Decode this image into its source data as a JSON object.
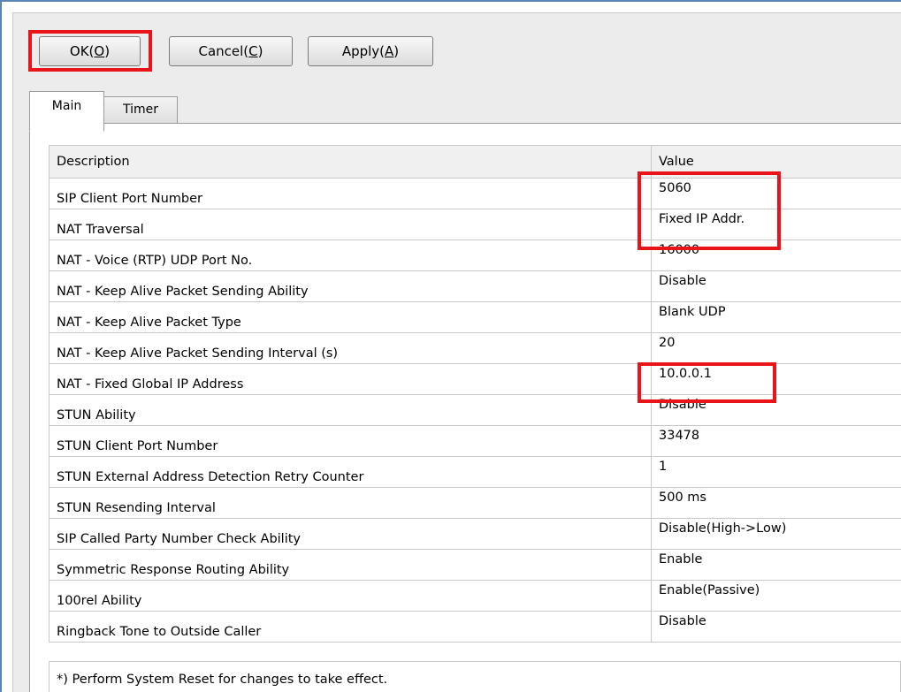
{
  "toolbar": {
    "ok_label": "OK(",
    "ok_key": "O",
    "cancel_label": "Cancel(",
    "cancel_key": "C",
    "apply_label": "Apply(",
    "apply_key": "A",
    "close_paren": ")"
  },
  "tabs": [
    {
      "label": "Main"
    },
    {
      "label": "Timer"
    }
  ],
  "grid": {
    "headers": {
      "description": "Description",
      "value": "Value"
    },
    "rows": [
      {
        "description": "SIP Client Port Number",
        "value": "5060"
      },
      {
        "description": "NAT Traversal",
        "value": "Fixed IP Addr."
      },
      {
        "description": "NAT - Voice (RTP) UDP Port No.",
        "value": "16000"
      },
      {
        "description": "NAT - Keep Alive Packet Sending Ability",
        "value": "Disable"
      },
      {
        "description": "NAT - Keep Alive Packet Type",
        "value": "Blank UDP"
      },
      {
        "description": "NAT - Keep Alive Packet Sending Interval (s)",
        "value": "20"
      },
      {
        "description": "NAT - Fixed Global IP Address",
        "value": "10.0.0.1"
      },
      {
        "description": "STUN Ability",
        "value": "Disable"
      },
      {
        "description": "STUN Client Port Number",
        "value": "33478"
      },
      {
        "description": "STUN External Address Detection Retry Counter",
        "value": "1"
      },
      {
        "description": "STUN Resending Interval",
        "value": "500 ms"
      },
      {
        "description": "SIP Called Party Number Check Ability",
        "value": "Disable(High->Low)"
      },
      {
        "description": "Symmetric Response Routing Ability",
        "value": "Enable"
      },
      {
        "description": "100rel Ability",
        "value": "Enable(Passive)"
      },
      {
        "description": "Ringback Tone to Outside Caller",
        "value": "Disable"
      }
    ]
  },
  "footer_note": "*) Perform System Reset for changes to take effect.",
  "colors": {
    "highlight": "#e8141a",
    "window_border": "#5a84b8"
  }
}
